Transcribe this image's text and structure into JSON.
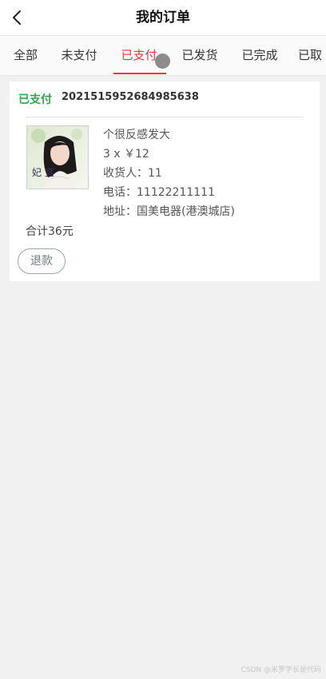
{
  "header": {
    "title": "我的订单",
    "back_icon": "chevron-left-icon"
  },
  "tabs": [
    {
      "label": "全部",
      "active": false
    },
    {
      "label": "未支付",
      "active": false
    },
    {
      "label": "已支付",
      "active": true
    },
    {
      "label": "已发货",
      "active": false
    },
    {
      "label": "已完成",
      "active": false
    },
    {
      "label": "已取",
      "active": false
    }
  ],
  "order": {
    "status": "已支付",
    "order_number": "20215159526849856​38",
    "product_name": "个很反感发大",
    "quantity_price": "3 x ￥12",
    "receiver": "收货人：11",
    "phone": "电话：11122211111",
    "address": "地址：国美电器(港澳城店)",
    "total": "合计36元",
    "refund_label": "退款",
    "thumb_text": "妃 宣"
  },
  "watermark": "CSDN @米罗学长是代码",
  "colors": {
    "accent_red": "#e3393c",
    "status_green": "#35a446",
    "background": "#f1f1f1"
  }
}
